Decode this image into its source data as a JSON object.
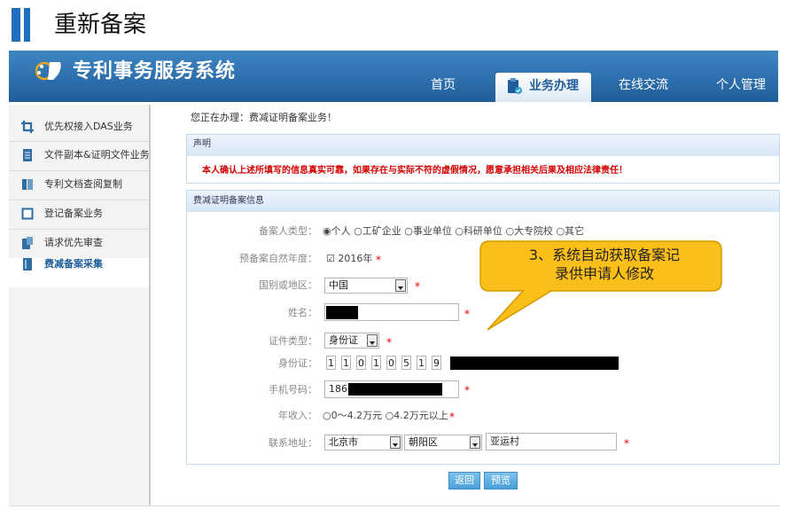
{
  "slide": {
    "title": "重新备案"
  },
  "app": {
    "name": "专利事务服务系统"
  },
  "nav": {
    "home": "首页",
    "business": "业务办理",
    "online": "在线交流",
    "personal": "个人管理"
  },
  "sidebar": {
    "items": [
      {
        "label": "优先权接入DAS业务",
        "icon": "crop-icon"
      },
      {
        "label": "文件副本&证明文件业务",
        "icon": "document-icon"
      },
      {
        "label": "专利文档查阅复制",
        "icon": "book-icon"
      },
      {
        "label": "登记备案业务",
        "icon": "blank-page-icon"
      },
      {
        "label": "请求优先审查",
        "icon": "clipboard-icon"
      },
      {
        "label": "费减备案采集",
        "icon": "ledger-icon"
      }
    ]
  },
  "main": {
    "doing": "您正在办理：费减证明备案业务！",
    "statement_title": "声明",
    "statement_text": "本人确认上述所填写的信息真实可靠，如果存在与实际不符的虚假情况，愿意承担相关后果及相应法律责任！",
    "info_title": "费减证明备案信息"
  },
  "form": {
    "filer_type_label": "备案人类型：",
    "filer_types": [
      "个人",
      "工矿企业",
      "事业单位",
      "科研单位",
      "大专院校",
      "其它"
    ],
    "year_label": "预备案自然年度：",
    "year_value": "2016年",
    "country_label": "国别或地区：",
    "country_value": "中国",
    "name_label": "姓名：",
    "id_type_label": "证件类型：",
    "id_type_value": "身份证",
    "id_label": "身份证：",
    "id_digits": [
      "1",
      "1",
      "0",
      "1",
      "0",
      "5",
      "1",
      "9"
    ],
    "phone_label": "手机号码：",
    "phone_value": "1860",
    "income_label": "年收入：",
    "income_opt1": "0～4.2万元",
    "income_opt2": "4.2万元以上",
    "address_label": "联系地址：",
    "address_city": "北京市",
    "address_district": "朝阳区",
    "address_detail": "亚运村",
    "required_mark": "*"
  },
  "buttons": {
    "back": "返回",
    "preview": "预览"
  },
  "callout": {
    "line1": "3、系统自动获取备案记",
    "line2": "录供申请人修改"
  },
  "colors": {
    "brand": "#1f6fbf",
    "header": "#2c6fad",
    "warning": "#d40000",
    "callout": "#fbbf1a"
  }
}
